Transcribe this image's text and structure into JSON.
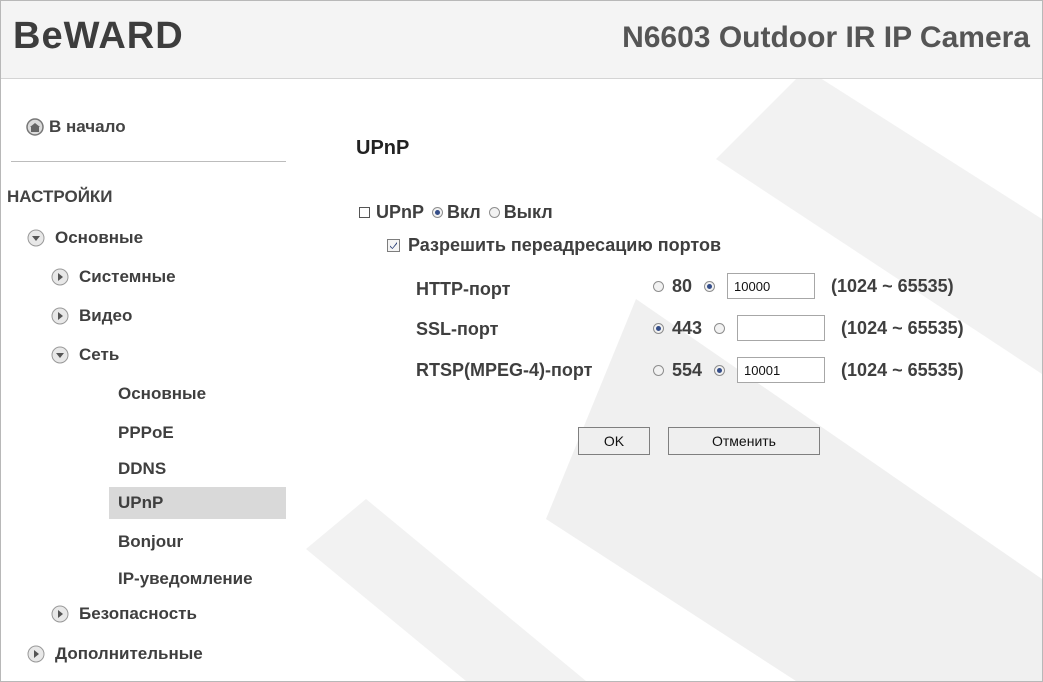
{
  "header": {
    "logo": "BeWARD",
    "model": "N6603 Outdoor IR IP Camera"
  },
  "sidebar": {
    "home_label": "В начало",
    "section_title": "НАСТРОЙКИ",
    "items": [
      {
        "label": "Основные",
        "icon": "chevron-down-icon"
      },
      {
        "label": "Системные",
        "icon": "chevron-right-icon"
      },
      {
        "label": "Видео",
        "icon": "chevron-right-icon"
      },
      {
        "label": "Сеть",
        "icon": "chevron-down-icon"
      },
      {
        "label": "Основные"
      },
      {
        "label": "PPPoE"
      },
      {
        "label": "DDNS"
      },
      {
        "label": "UPnP",
        "active": true
      },
      {
        "label": "Bonjour"
      },
      {
        "label": "IP-уведомление"
      },
      {
        "label": "Безопасность",
        "icon": "chevron-right-icon"
      },
      {
        "label": "Дополнительные",
        "icon": "chevron-right-icon"
      }
    ]
  },
  "main": {
    "title": "UPnP",
    "upnp_label": "UPnP",
    "on_label": "Вкл",
    "off_label": "Выкл",
    "forward_label": "Разрешить переадресацию портов",
    "http": {
      "label": "HTTP-порт",
      "default": "80",
      "value": "10000",
      "range": "(1024 ~ 65535)"
    },
    "ssl": {
      "label": "SSL-порт",
      "default": "443",
      "value": "",
      "range": "(1024 ~ 65535)"
    },
    "rtsp": {
      "label": "RTSP(MPEG-4)-порт",
      "default": "554",
      "value": "10001",
      "range": "(1024 ~ 65535)"
    },
    "ok": "OK",
    "cancel": "Отменить"
  },
  "colors": {
    "accent": "#344d88",
    "active_bg": "#d9d9d9",
    "header_bg": "#f4f4f4"
  }
}
